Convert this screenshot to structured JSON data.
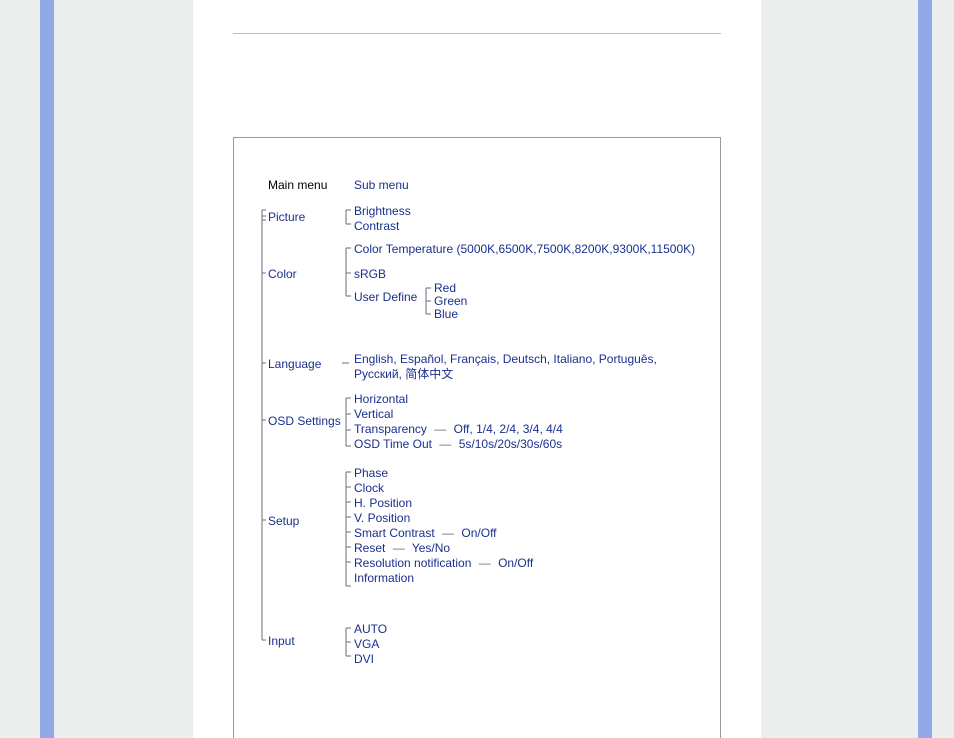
{
  "headers": {
    "main": "Main menu",
    "sub": "Sub menu"
  },
  "menu": {
    "picture": {
      "label": "Picture",
      "items": {
        "brightness": "Brightness",
        "contrast": "Contrast"
      }
    },
    "color": {
      "label": "Color",
      "ct": "Color Temperature (5000K,6500K,7500K,8200K,9300K,11500K)",
      "srgb": "sRGB",
      "ud": "User Define",
      "rgb": {
        "r": "Red",
        "g": "Green",
        "b": "Blue"
      }
    },
    "language": {
      "label": "Language",
      "text": "English, Español, Français, Deutsch, Italiano, Português, Русский, 简体中文"
    },
    "osd": {
      "label": "OSD Settings",
      "horizontal": "Horizontal",
      "vertical": "Vertical",
      "transparency": "Transparency",
      "transparency_opts": "Off, 1/4, 2/4, 3/4, 4/4",
      "timeout": "OSD Time Out",
      "timeout_opts": "5s/10s/20s/30s/60s"
    },
    "setup": {
      "label": "Setup",
      "phase": "Phase",
      "clock": "Clock",
      "hpos": "H. Position",
      "vpos": "V. Position",
      "sc": "Smart Contrast",
      "sc_opts": "On/Off",
      "reset": "Reset",
      "reset_opts": "Yes/No",
      "rn": "Resolution notification",
      "rn_opts": "On/Off",
      "info": "Information"
    },
    "input": {
      "label": "Input",
      "auto": "AUTO",
      "vga": "VGA",
      "dvi": "DVI"
    }
  },
  "glyphs": {
    "dash": "—"
  }
}
